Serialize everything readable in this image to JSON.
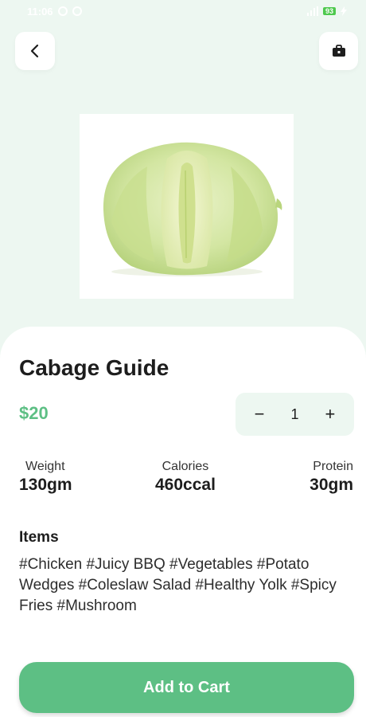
{
  "status_bar": {
    "time": "11:06",
    "battery": "93"
  },
  "header": {
    "back_icon": "chevron-left-icon",
    "bag_icon": "shopping-bag-icon"
  },
  "product": {
    "title": "Cabage Guide",
    "price": "$20",
    "image": "cabbage-image",
    "quantity": {
      "minus_label": "−",
      "value": "1",
      "plus_label": "+"
    }
  },
  "nutrition": {
    "weight": {
      "label": "Weight",
      "value": "130gm"
    },
    "calories": {
      "label": "Calories",
      "value": "460ccal"
    },
    "protein": {
      "label": "Protein",
      "value": "30gm"
    }
  },
  "items": {
    "heading": "Items",
    "tags": "#Chicken #Juicy BBQ #Vegetables #Potato Wedges #Coleslaw Salad #Healthy Yolk #Spicy Fries #Mushroom"
  },
  "actions": {
    "add_to_cart": "Add to Cart"
  },
  "colors": {
    "accent": "#5dbf84",
    "background": "#edf7f1",
    "card": "#ffffff"
  }
}
